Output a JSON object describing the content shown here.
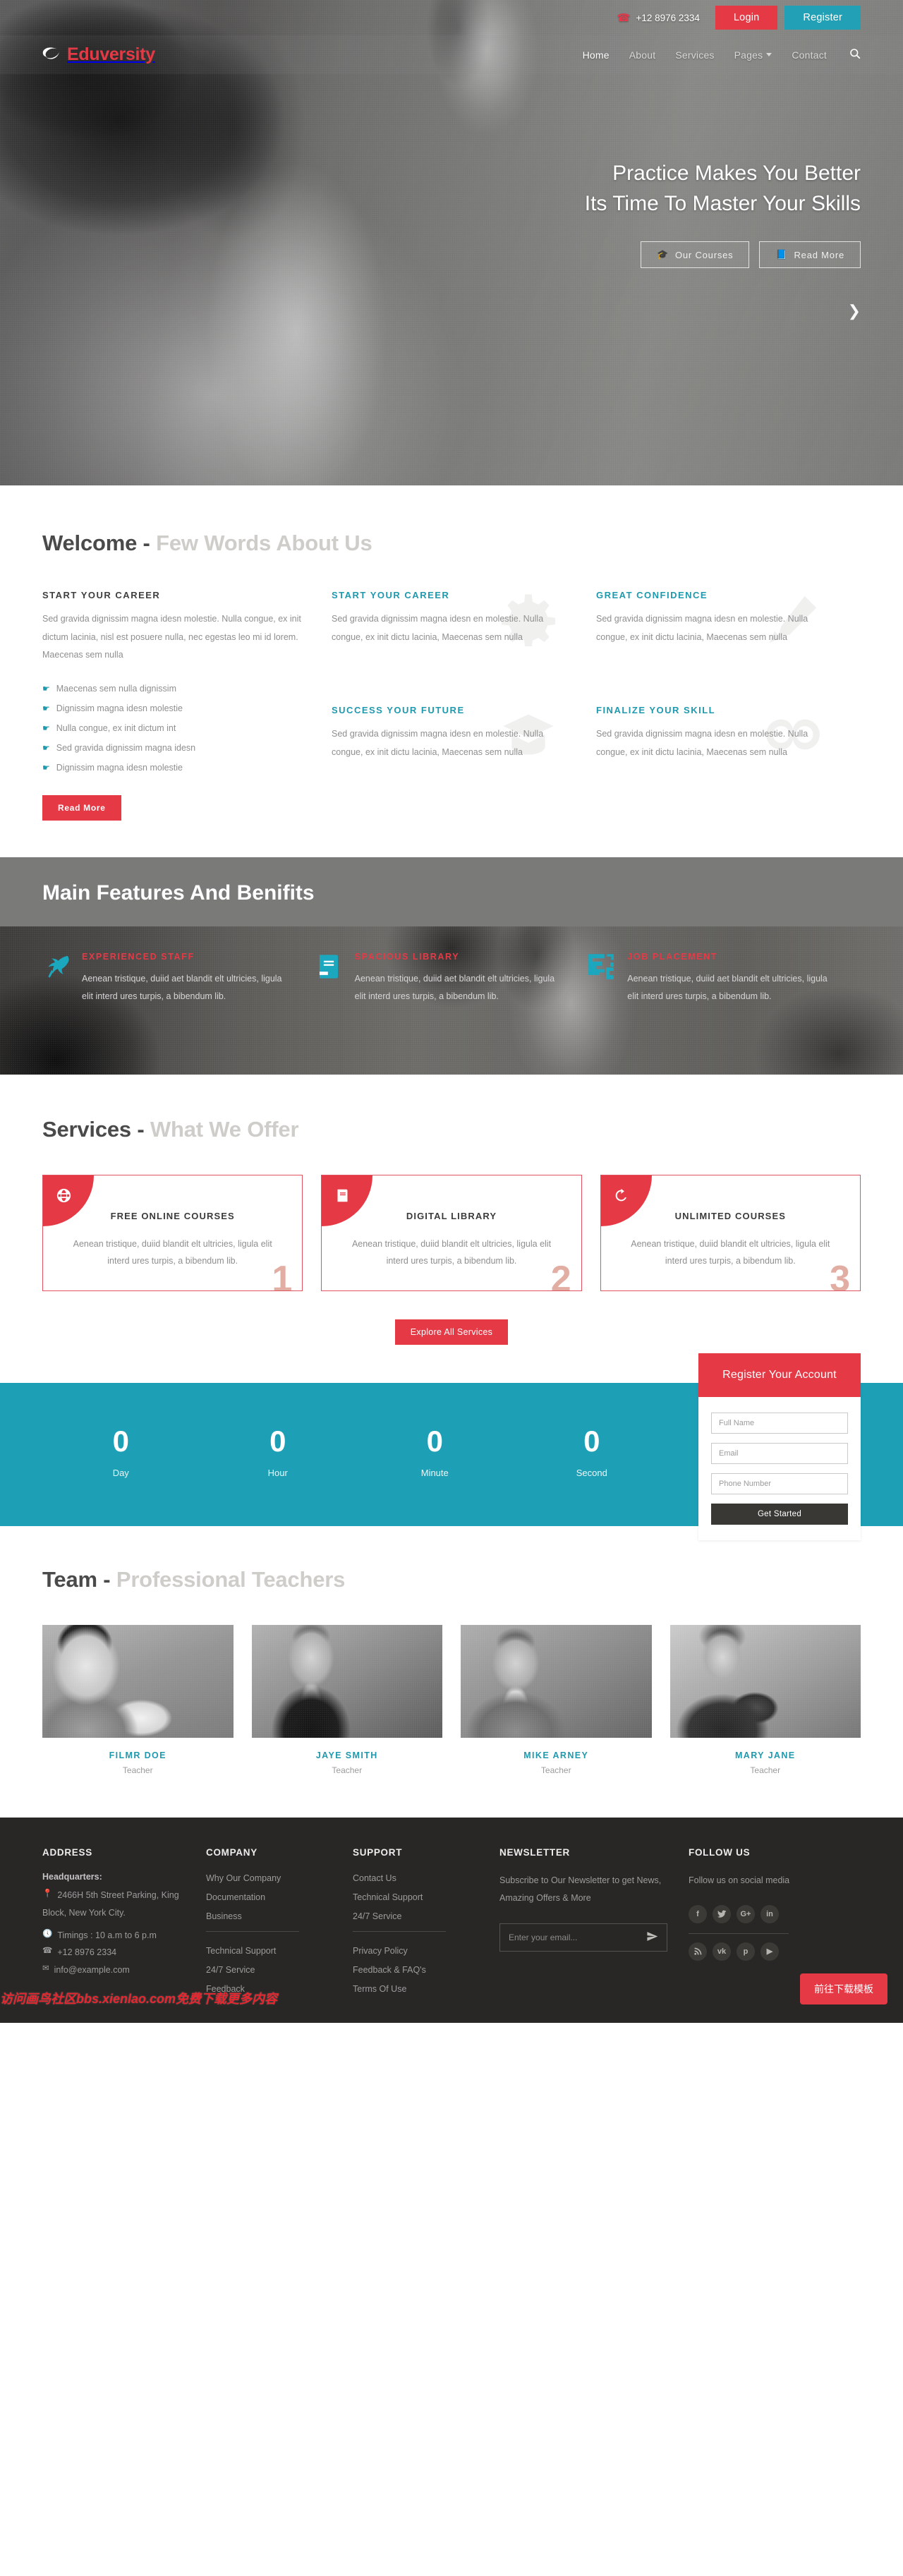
{
  "topbar": {
    "phone_icon": "phone-icon",
    "phone": "+12 8976 2334",
    "login_label": "Login",
    "register_label": "Register"
  },
  "brand": {
    "name": "Eduversity",
    "logo_icon": "crescent-logo-icon",
    "color": "#e63946"
  },
  "nav": {
    "items": [
      {
        "label": "Home",
        "active": true
      },
      {
        "label": "About",
        "active": false
      },
      {
        "label": "Services",
        "active": false
      },
      {
        "label": "Pages",
        "active": false,
        "has_dropdown": true
      },
      {
        "label": "Contact",
        "active": false
      }
    ],
    "search_icon": "search-icon"
  },
  "hero": {
    "line1": "Practice Makes You Better",
    "line2": "Its Time To Master Your Skills",
    "btn1": {
      "label": "Our Courses",
      "icon": "graduation-cap-icon"
    },
    "btn2": {
      "label": "Read More",
      "icon": "book-icon"
    },
    "scroll_icon": "chevron-double-down-icon"
  },
  "welcome": {
    "head_dark": "Welcome -",
    "head_light": "Few Words About Us",
    "left": {
      "title": "START YOUR CAREER",
      "paragraph": "Sed gravida dignissim magna idesn molestie. Nulla congue, ex init dictum lacinia, nisl est posuere nulla, nec egestas leo mi id lorem. Maecenas sem nulla",
      "bullets": [
        "Maecenas sem nulla dignissim",
        "Dignissim magna idesn molestie",
        "Nulla congue, ex init dictum int",
        "Sed gravida dignissim magna idesn",
        "Dignissim magna idesn molestie"
      ],
      "button": "Read More"
    },
    "cells": [
      {
        "title": "START YOUR CAREER",
        "text": "Sed gravida dignissim magna idesn en molestie. Nulla congue, ex init dictu lacinia, Maecenas sem nulla",
        "watermark": "gear-icon"
      },
      {
        "title": "GREAT CONFIDENCE",
        "text": "Sed gravida dignissim magna idesn en molestie. Nulla congue, ex init dictu lacinia, Maecenas sem nulla",
        "watermark": "pencil-icon"
      },
      {
        "title": "SUCCESS YOUR FUTURE",
        "text": "Sed gravida dignissim magna idesn en molestie. Nulla congue, ex init dictu lacinia, Maecenas sem nulla",
        "watermark": "graduation-cap-icon"
      },
      {
        "title": "FINALIZE YOUR SKILL",
        "text": "Sed gravida dignissim magna idesn en molestie. Nulla congue, ex init dictu lacinia, Maecenas sem nulla",
        "watermark": "infinity-icon"
      }
    ]
  },
  "features": {
    "heading": "Main Features And Benifits",
    "items": [
      {
        "title": "EXPERIENCED STAFF",
        "text": "Aenean tristique, duiid aet blandit elt ultricies, ligula elit interd ures turpis, a bibendum lib.",
        "icon": "dove-icon"
      },
      {
        "title": "SPACIOUS LIBRARY",
        "text": "Aenean tristique, duiid aet blandit elt ultricies, ligula elit interd ures turpis, a bibendum lib.",
        "icon": "book-icon"
      },
      {
        "title": "JOB PLACEMENT",
        "text": "Aenean tristique, duiid aet blandit elt ultricies, ligula elit interd ures turpis, a bibendum lib.",
        "icon": "maze-icon"
      }
    ]
  },
  "services": {
    "head_dark": "Services -",
    "head_light": "What We Offer",
    "cards": [
      {
        "title": "FREE ONLINE COURSES",
        "text": "Aenean tristique, duiid blandit elt ultricies, ligula elit interd ures turpis, a bibendum lib.",
        "number": "1",
        "icon": "globe-icon"
      },
      {
        "title": "DIGITAL LIBRARY",
        "text": "Aenean tristique, duiid blandit elt ultricies, ligula elit interd ures turpis, a bibendum lib.",
        "number": "2",
        "icon": "book-icon"
      },
      {
        "title": "UNLIMITED COURSES",
        "text": "Aenean tristique, duiid blandit elt ultricies, ligula elit interd ures turpis, a bibendum lib.",
        "number": "3",
        "icon": "refresh-icon"
      }
    ],
    "cta": "Explore All Services"
  },
  "countdown": {
    "items": [
      {
        "value": "0",
        "label": "Day"
      },
      {
        "value": "0",
        "label": "Hour"
      },
      {
        "value": "0",
        "label": "Minute"
      },
      {
        "value": "0",
        "label": "Second"
      }
    ],
    "bg_color": "#1d9fb5"
  },
  "register": {
    "title": "Register Your Account",
    "fields": [
      {
        "name": "full-name",
        "placeholder": "Full Name",
        "value": ""
      },
      {
        "name": "email",
        "placeholder": "Email",
        "value": ""
      },
      {
        "name": "phone",
        "placeholder": "Phone Number",
        "value": ""
      }
    ],
    "submit": "Get Started"
  },
  "team": {
    "head_dark": "Team -",
    "head_light": "Professional Teachers",
    "members": [
      {
        "name": "FILMR DOE",
        "role": "Teacher"
      },
      {
        "name": "JAYE SMITH",
        "role": "Teacher"
      },
      {
        "name": "MIKE ARNEY",
        "role": "Teacher"
      },
      {
        "name": "MARY JANE",
        "role": "Teacher"
      }
    ]
  },
  "footer": {
    "address": {
      "heading": "ADDRESS",
      "hq_label": "Headquarters:",
      "street": "2466H 5th Street Parking, King",
      "city": "Block, New York City.",
      "timings": "Timings : 10 a.m to 6 p.m",
      "phone": "+12 8976 2334",
      "email": "info@example.com",
      "pin_icon": "map-pin-icon",
      "clock_icon": "clock-icon",
      "phone_icon": "phone-icon",
      "mail_icon": "envelope-icon"
    },
    "company": {
      "heading": "COMPANY",
      "group1": [
        "Why Our Company",
        "Documentation",
        "Business"
      ],
      "group2": [
        "Technical Support",
        "24/7 Service",
        "Feedback"
      ]
    },
    "support": {
      "heading": "SUPPORT",
      "group1": [
        "Contact Us",
        "Technical Support",
        "24/7 Service"
      ],
      "group2": [
        "Privacy Policy",
        "Feedback & FAQ's",
        "Terms Of Use"
      ]
    },
    "newsletter": {
      "heading": "NEWSLETTER",
      "text": "Subscribe to Our Newsletter to get News, Amazing Offers & More",
      "placeholder": "Enter your email...",
      "send_icon": "paper-plane-icon"
    },
    "follow": {
      "heading": "FOLLOW US",
      "text": "Follow us on social media",
      "row1": [
        "facebook-icon",
        "twitter-icon",
        "google-plus-icon",
        "linkedin-icon"
      ],
      "row2": [
        "rss-icon",
        "vk-icon",
        "pinterest-icon",
        "youtube-icon"
      ]
    }
  },
  "overlay": {
    "watermark": "访问画鸟社区bbs.xienlao.com免费下载更多内容",
    "download_button": "前往下载模板"
  }
}
